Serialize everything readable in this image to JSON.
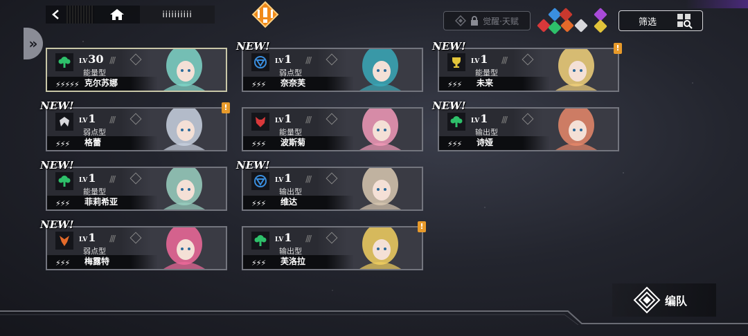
{
  "topbar": {
    "back_icon": "back-arrow-icon",
    "home_icon": "home-icon",
    "crumb": "iiiiiiiiii"
  },
  "talent_button": {
    "label": "觉醒·天赋",
    "icon": "lock-icon"
  },
  "filter_button": {
    "label": "筛选",
    "icon": "grid-search-icon"
  },
  "team_button": {
    "label": "编队",
    "icon": "formation-icon"
  },
  "element_filters": [
    {
      "name": "wolf-red",
      "color": "#d8383a"
    },
    {
      "name": "blue-swirl",
      "color": "#3a8fe0"
    },
    {
      "name": "orange-crest",
      "color": "#e36a2a"
    },
    {
      "name": "white-crest",
      "color": "#d8d8dc"
    },
    {
      "name": "purple-crest",
      "color": "#a84ad8"
    },
    {
      "name": "green-crest",
      "color": "#2ec06a"
    },
    {
      "name": "yellow-crest",
      "color": "#e2c43a"
    },
    {
      "name": "red-crest",
      "color": "#c8382e"
    }
  ],
  "characters": [
    {
      "name": "克尔苏娜",
      "level": "30",
      "lv_prefix": "LV",
      "type": "能量型",
      "stars": "⚡⚡⚡⚡⚡",
      "icon": "tree",
      "icon_color": "#2ec06a",
      "is_new": false,
      "has_alert": false,
      "hero": true,
      "accent": "#7fd6c8"
    },
    {
      "name": "奈奈芙",
      "level": "1",
      "lv_prefix": "LV",
      "type": "弱点型",
      "stars": "⚡⚡⚡",
      "icon": "shield",
      "icon_color": "#3a8fe0",
      "is_new": true,
      "has_alert": false,
      "hero": false,
      "accent": "#3aa9b8"
    },
    {
      "name": "未来",
      "level": "1",
      "lv_prefix": "LV",
      "type": "能量型",
      "stars": "⚡⚡⚡",
      "icon": "trophy",
      "icon_color": "#e2c43a",
      "is_new": true,
      "has_alert": true,
      "hero": false,
      "accent": "#f2d27a"
    },
    {
      "name": "格蕾",
      "level": "1",
      "lv_prefix": "LV",
      "type": "弱点型",
      "stars": "⚡⚡⚡",
      "icon": "wings",
      "icon_color": "#d8d8dc",
      "is_new": true,
      "has_alert": true,
      "hero": false,
      "accent": "#c9d2e0"
    },
    {
      "name": "波斯菊",
      "level": "1",
      "lv_prefix": "LV",
      "type": "能量型",
      "stars": "⚡⚡⚡",
      "icon": "wolf",
      "icon_color": "#d8383a",
      "is_new": false,
      "has_alert": false,
      "hero": false,
      "accent": "#f29ab8"
    },
    {
      "name": "诗娅",
      "level": "1",
      "lv_prefix": "LV",
      "type": "输出型",
      "stars": "⚡⚡⚡",
      "icon": "tree",
      "icon_color": "#2ec06a",
      "is_new": true,
      "has_alert": false,
      "hero": false,
      "accent": "#e8886a"
    },
    {
      "name": "菲莉希亚",
      "level": "1",
      "lv_prefix": "LV",
      "type": "能量型",
      "stars": "⚡⚡⚡",
      "icon": "tree",
      "icon_color": "#2ec06a",
      "is_new": true,
      "has_alert": false,
      "hero": false,
      "accent": "#9ad0c0"
    },
    {
      "name": "维达",
      "level": "1",
      "lv_prefix": "LV",
      "type": "输出型",
      "stars": "⚡⚡⚡",
      "icon": "shield",
      "icon_color": "#3a8fe0",
      "is_new": true,
      "has_alert": false,
      "hero": false,
      "accent": "#d8c8b0"
    },
    {
      "name": "梅露特",
      "level": "1",
      "lv_prefix": "LV",
      "type": "弱点型",
      "stars": "⚡⚡⚡",
      "icon": "crest",
      "icon_color": "#e36a2a",
      "is_new": true,
      "has_alert": false,
      "hero": false,
      "accent": "#f06a9a"
    },
    {
      "name": "芙洛拉",
      "level": "1",
      "lv_prefix": "LV",
      "type": "输出型",
      "stars": "⚡⚡⚡",
      "icon": "tree",
      "icon_color": "#2ec06a",
      "is_new": false,
      "has_alert": true,
      "hero": false,
      "accent": "#f2d060"
    }
  ],
  "new_label": "NEW!",
  "alert_label": "!"
}
